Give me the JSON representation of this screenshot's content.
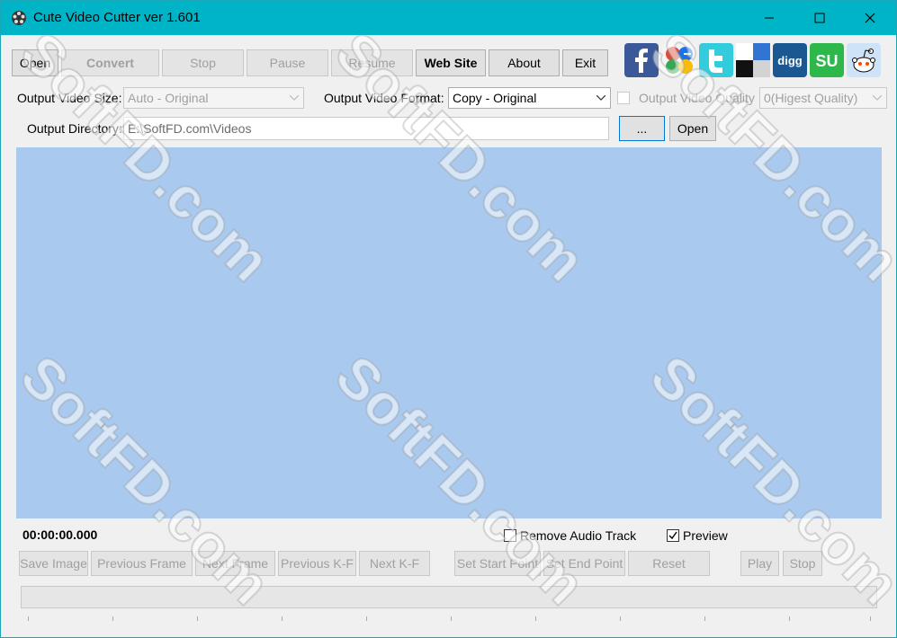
{
  "window": {
    "title": "Cute Video Cutter ver 1.601"
  },
  "toolbar": {
    "open": "Open",
    "convert": "Convert",
    "stop": "Stop",
    "pause": "Pause",
    "resume": "Resume",
    "website": "Web Site",
    "about": "About",
    "exit": "Exit"
  },
  "social": [
    "facebook-icon",
    "google-icon",
    "twitter-icon",
    "delicious-icon",
    "digg-icon",
    "stumbleupon-icon",
    "reddit-icon"
  ],
  "social_text": {
    "digg": "digg",
    "stumble": "SU"
  },
  "settings": {
    "size_label": "Output Video Size:",
    "size_value": "Auto - Original",
    "format_label": "Output Video Format:",
    "format_value": "Copy - Original",
    "quality_label": "Output Video Quality",
    "quality_value": "0(Higest Quality)",
    "dir_label": "Output Directory:",
    "dir_value": "E:\\SoftFD.com\\Videos",
    "browse": "...",
    "open_dir": "Open"
  },
  "player": {
    "time": "00:00:00.000",
    "remove_audio": "Remove Audio Track",
    "remove_audio_checked": false,
    "preview": "Preview",
    "preview_checked": true
  },
  "controls": {
    "save_image": "Save Image",
    "prev_frame": "Previous Frame",
    "next_frame": "Next Frame",
    "prev_kf": "Previous K-F",
    "next_kf": "Next K-F",
    "set_start": "Set  Start Point",
    "set_end": "Set  End Point",
    "reset": "Reset",
    "play": "Play",
    "stop": "Stop"
  },
  "watermark": "SoftFD.com",
  "colors": {
    "titlebar": "#00b4c7",
    "video_area": "#a9c9ee"
  }
}
